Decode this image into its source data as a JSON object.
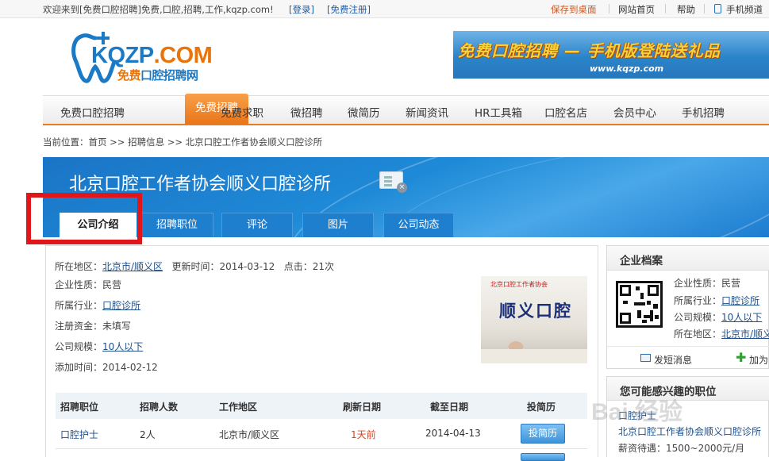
{
  "topbar": {
    "welcome": "欢迎来到[免费口腔招聘]免费,口腔,招聘,工作,kqzp.com!",
    "login": "[登录]",
    "register": "[免费注册]",
    "save_desktop": "保存到桌面",
    "home": "网站首页",
    "help": "帮助",
    "mobile": "手机频道"
  },
  "logo": {
    "brand_part1": "KQZP",
    "brand_part2": ".COM",
    "slogan_part1": "免费",
    "slogan_part2": "口腔招聘网"
  },
  "banner": {
    "headline": "免费口腔招聘 — 手机版登陆送礼品",
    "url": "www.kqzp.com"
  },
  "nav": {
    "items": [
      "免费口腔招聘",
      "免费招聘",
      "免费求职",
      "微招聘",
      "微简历",
      "新闻资讯",
      "HR工具箱",
      "口腔名店",
      "会员中心",
      "手机招聘"
    ],
    "active": "免费招聘"
  },
  "breadcrumb": "当前位置：首页 >> 招聘信息 >> 北京口腔工作者协会顺义口腔诊所",
  "company": {
    "name": "北京口腔工作者协会顺义口腔诊所",
    "tabs": [
      "公司介绍",
      "招聘职位",
      "评论",
      "图片",
      "公司动态"
    ]
  },
  "info": {
    "region_label": "所在地区：",
    "region_value": "北京市/顺义区",
    "update_label": "更新时间：2014-03-12",
    "clicks_label": "点击：21次",
    "nature": "企业性质：民营",
    "industry_label": "所属行业：",
    "industry_value": "口腔诊所",
    "capital": "注册资金：未填写",
    "scale_label": "公司规模：",
    "scale_value": "10人以下",
    "added": "添加时间：2014-02-12"
  },
  "photo": {
    "sign_text": "顺义口腔",
    "small_text": "北京口腔工作者协会"
  },
  "jobs": {
    "headers": [
      "招聘职位",
      "招聘人数",
      "工作地区",
      "刷新日期",
      "截至日期",
      "投简历"
    ],
    "rows": [
      {
        "title": "口腔护士",
        "count": "2人",
        "area": "北京市/顺义区",
        "refresh": "1天前",
        "deadline": "2014-04-13",
        "apply": "投简历"
      }
    ]
  },
  "profile": {
    "title": "企业档案",
    "nature": "企业性质：民营",
    "industry_label": "所属行业：",
    "industry_value": "口腔诊所",
    "scale_label": "公司规模：",
    "scale_value": "10人以下",
    "region_label": "所在地区：",
    "region_value": "北京市/顺义",
    "msg": "发短消息",
    "add": "加为"
  },
  "interest": {
    "title": "您可能感兴趣的职位",
    "job": "口腔护士",
    "company": "北京口腔工作者协会顺义口腔诊所",
    "salary": "薪资待遇：1500~2000元/月"
  },
  "watermark": "Bai 经验",
  "colors": {
    "accent": "#ea7b1e",
    "brand_blue": "#1f7fcf",
    "highlight": "#e0161b"
  }
}
